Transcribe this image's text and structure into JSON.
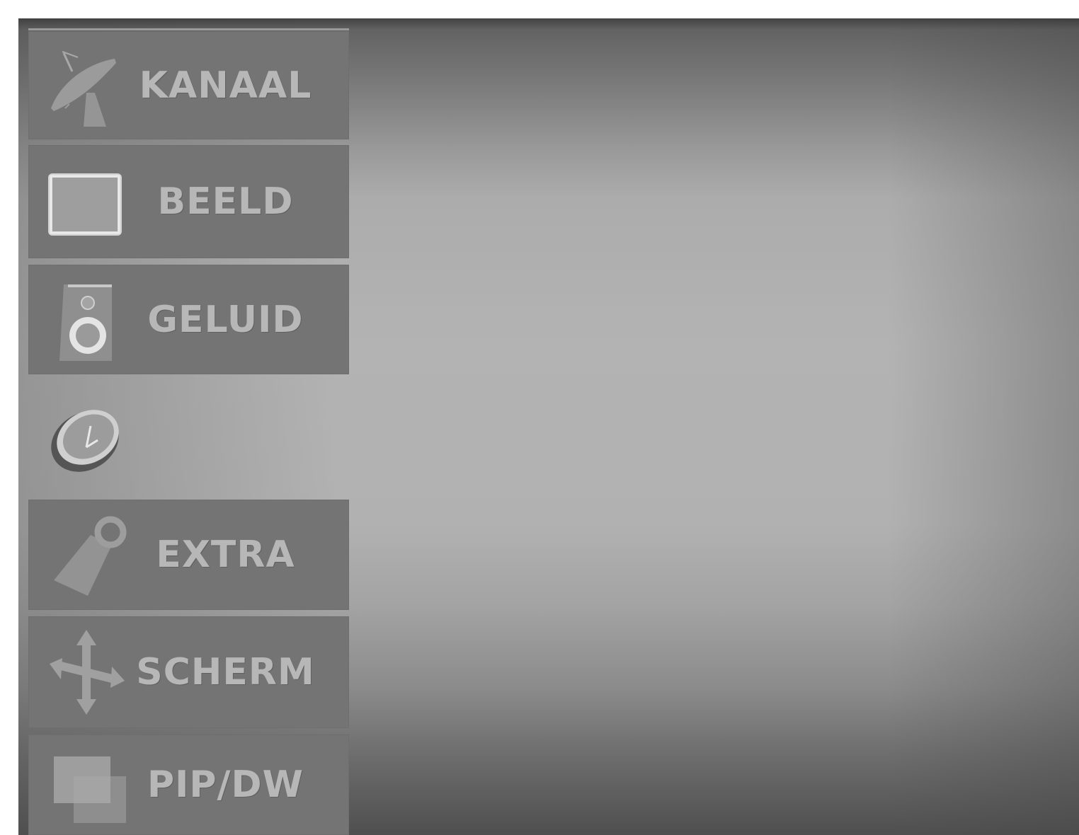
{
  "menu": {
    "items": [
      {
        "id": "kanaal",
        "label": "KANAAL",
        "icon": "satellite-dish-icon",
        "selected": false
      },
      {
        "id": "beeld",
        "label": "BEELD",
        "icon": "picture-screen-icon",
        "selected": false
      },
      {
        "id": "geluid",
        "label": "GELUID",
        "icon": "speaker-icon",
        "selected": false
      },
      {
        "id": "tijd",
        "label": "",
        "icon": "clock-icon",
        "selected": true
      },
      {
        "id": "extra",
        "label": "EXTRA",
        "icon": "tag-icon",
        "selected": false
      },
      {
        "id": "scherm",
        "label": "SCHERM",
        "icon": "move-arrows-icon",
        "selected": false
      },
      {
        "id": "pip",
        "label": "PIP/DW",
        "icon": "pip-windows-icon",
        "selected": false
      }
    ]
  },
  "colors": {
    "item_background": "#747474",
    "label_text": "#b7b7b7",
    "screen_center": "#b3b3b3",
    "screen_edge": "#4f4f4f"
  }
}
